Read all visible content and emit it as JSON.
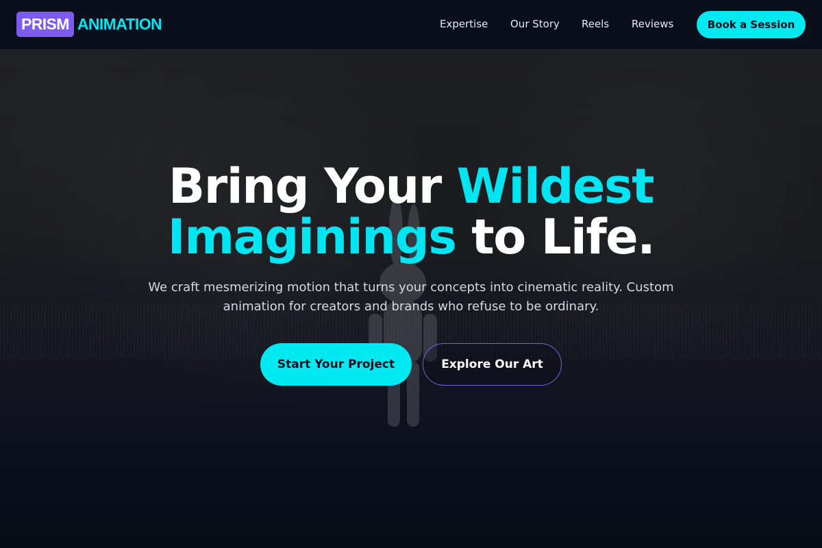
{
  "header": {
    "logo_mark": "PRISM",
    "logo_word": "ANIMATION",
    "nav": [
      "Expertise",
      "Our Story",
      "Reels",
      "Reviews"
    ],
    "cta_label": "Book a Session"
  },
  "hero": {
    "title_part1": "Bring Your ",
    "title_accent1": "Wildest",
    "title_accent2": "Imaginings",
    "title_part2": " to Life.",
    "subtitle": "We craft mesmerizing motion that turns your concepts into cinematic reality. Custom animation for creators and brands who refuse to be ordinary.",
    "primary_button": "Start Your Project",
    "secondary_button": "Explore Our Art"
  },
  "colors": {
    "accent": "#00e5f2",
    "brand_purple": "#7c5cf0",
    "background": "#070b15",
    "header_bg": "#0a0f1c"
  },
  "icons": [
    "background-figure-image"
  ]
}
